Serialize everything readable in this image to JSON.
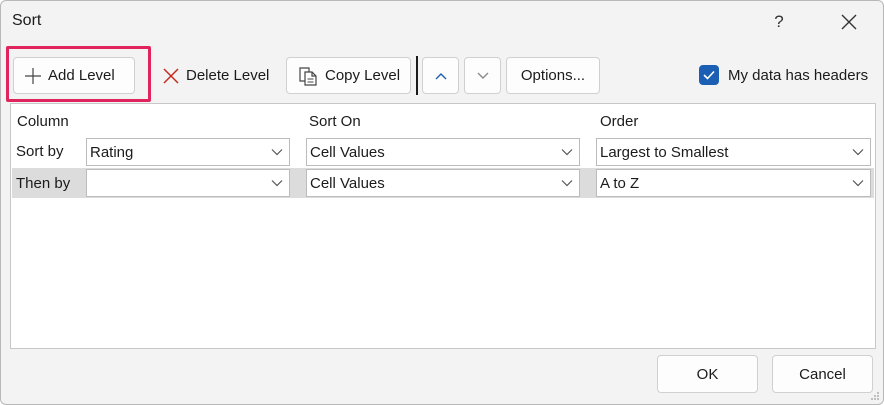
{
  "dialog": {
    "title": "Sort",
    "help_label": "?",
    "close_icon": "close-icon"
  },
  "toolbar": {
    "add_level": "Add Level",
    "delete_level": "Delete Level",
    "copy_level": "Copy Level",
    "move_up_icon": "chevron-up-icon",
    "move_down_icon": "chevron-down-icon",
    "options": "Options...",
    "headers_checkbox": {
      "label": "My data has headers",
      "checked": true
    }
  },
  "grid": {
    "headers": {
      "column": "Column",
      "sort_on": "Sort On",
      "order": "Order"
    },
    "rows": [
      {
        "label": "Sort by",
        "column": "Rating",
        "sort_on": "Cell Values",
        "order": "Largest to Smallest"
      },
      {
        "label": "Then by",
        "column": "",
        "sort_on": "Cell Values",
        "order": "A to Z"
      }
    ]
  },
  "footer": {
    "ok": "OK",
    "cancel": "Cancel"
  },
  "colors": {
    "accent": "#1a5fb4",
    "highlight": "#e0245e",
    "delete_red": "#c42b1c"
  }
}
